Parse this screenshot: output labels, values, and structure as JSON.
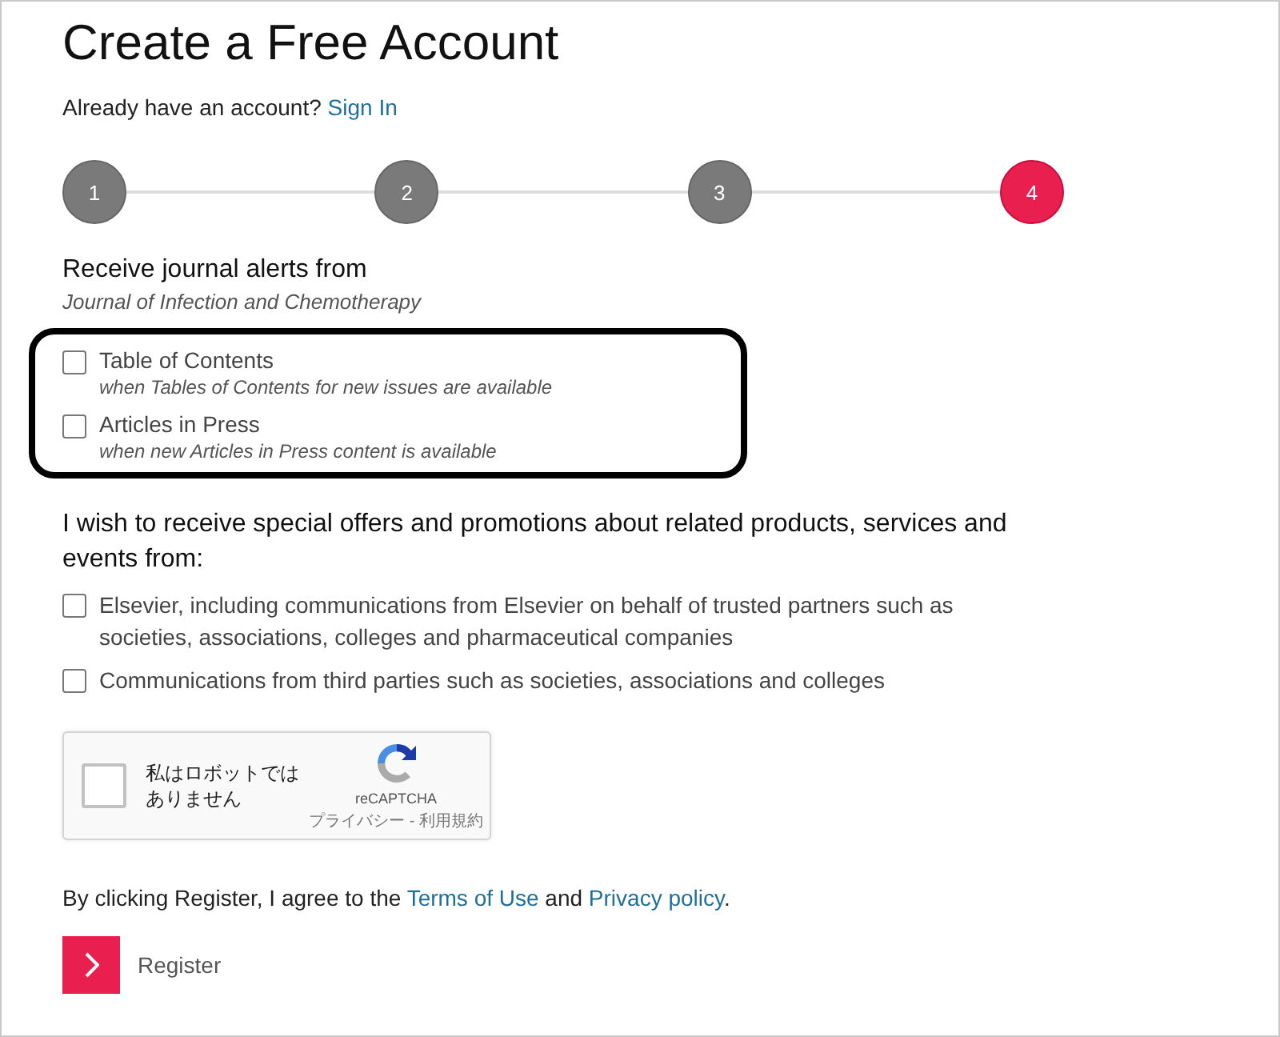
{
  "title": "Create a Free Account",
  "signin": [
    {
      "kind": "text",
      "text": "Already have an account? "
    },
    {
      "kind": "link",
      "text": "Sign In"
    }
  ],
  "steps": [
    {
      "label": "1",
      "selected": false
    },
    {
      "label": "2",
      "selected": false
    },
    {
      "label": "3",
      "selected": false
    },
    {
      "label": "4",
      "selected": true
    }
  ],
  "alerts": {
    "heading": "Receive journal alerts from",
    "journal": "Journal of Infection and Chemotherapy",
    "options": [
      {
        "label": "Table of Contents",
        "hint": "when Tables of Contents for new issues are available",
        "checked": false
      },
      {
        "label": "Articles in Press",
        "hint": "when new Articles in Press content is available",
        "checked": false
      }
    ]
  },
  "offers": {
    "heading": "I wish to receive special offers and promotions about related products, services and events from:",
    "options": [
      {
        "label": "Elsevier, including communications from Elsevier on behalf of trusted partners such as societies, associations, colleges and pharmaceutical companies",
        "checked": false
      },
      {
        "label": "Communications from third parties such as societies, associations and colleges",
        "checked": false
      }
    ]
  },
  "captcha": {
    "label": "私はロボットではありません",
    "checked": false,
    "brand": "reCAPTCHA",
    "links": "プライバシー - 利用規約"
  },
  "agreement": [
    {
      "kind": "text",
      "text": "By clicking Register, I agree to the "
    },
    {
      "kind": "link",
      "text": "Terms of Use"
    },
    {
      "kind": "text",
      "text": " and "
    },
    {
      "kind": "link",
      "text": "Privacy policy"
    },
    {
      "kind": "text",
      "text": "."
    }
  ],
  "register": {
    "label": "Register"
  }
}
